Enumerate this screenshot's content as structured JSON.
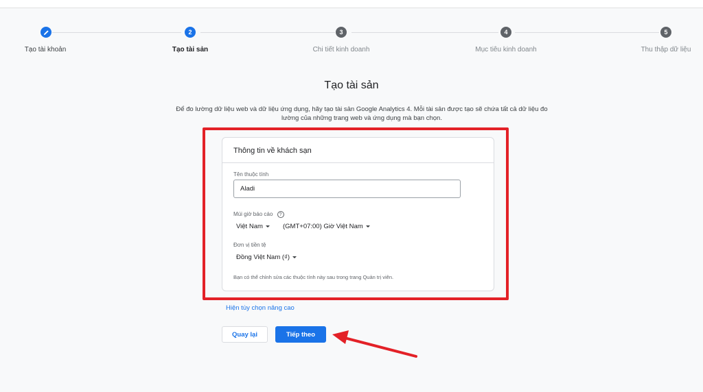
{
  "stepper": {
    "steps": [
      {
        "number": "",
        "label": "Tạo tài khoản",
        "state": "done"
      },
      {
        "number": "2",
        "label": "Tạo tài sản",
        "state": "active"
      },
      {
        "number": "3",
        "label": "Chi tiết kinh doanh",
        "state": "pending"
      },
      {
        "number": "4",
        "label": "Mục tiêu kinh doanh",
        "state": "pending"
      },
      {
        "number": "5",
        "label": "Thu thập dữ liệu",
        "state": "pending"
      }
    ]
  },
  "page": {
    "title": "Tạo tài sản",
    "description": "Để đo lường dữ liệu web và dữ liệu ứng dụng, hãy tạo tài sản Google Analytics 4. Mỗi tài sản được tạo sẽ chứa tất cả dữ liệu đo lường của những trang web và ứng dụng mà bạn chọn."
  },
  "card": {
    "header": "Thông tin về khách sạn",
    "property_name_label": "Tên thuộc tính",
    "property_name_value": "Aladi",
    "timezone_label": "Múi giờ báo cáo",
    "timezone_country": "Việt Nam",
    "timezone_value": "(GMT+07:00) Giờ Việt Nam",
    "currency_label": "Đơn vị tiền tệ",
    "currency_value": "Đồng Việt Nam (₫)",
    "footnote": "Bạn có thể chỉnh sửa các thuộc tính này sau trong trang Quản trị viên."
  },
  "advanced_link": "Hiện tùy chọn nâng cao",
  "buttons": {
    "back": "Quay lại",
    "next": "Tiếp theo"
  },
  "colors": {
    "accent": "#1a73e8",
    "highlight": "#e32127"
  }
}
